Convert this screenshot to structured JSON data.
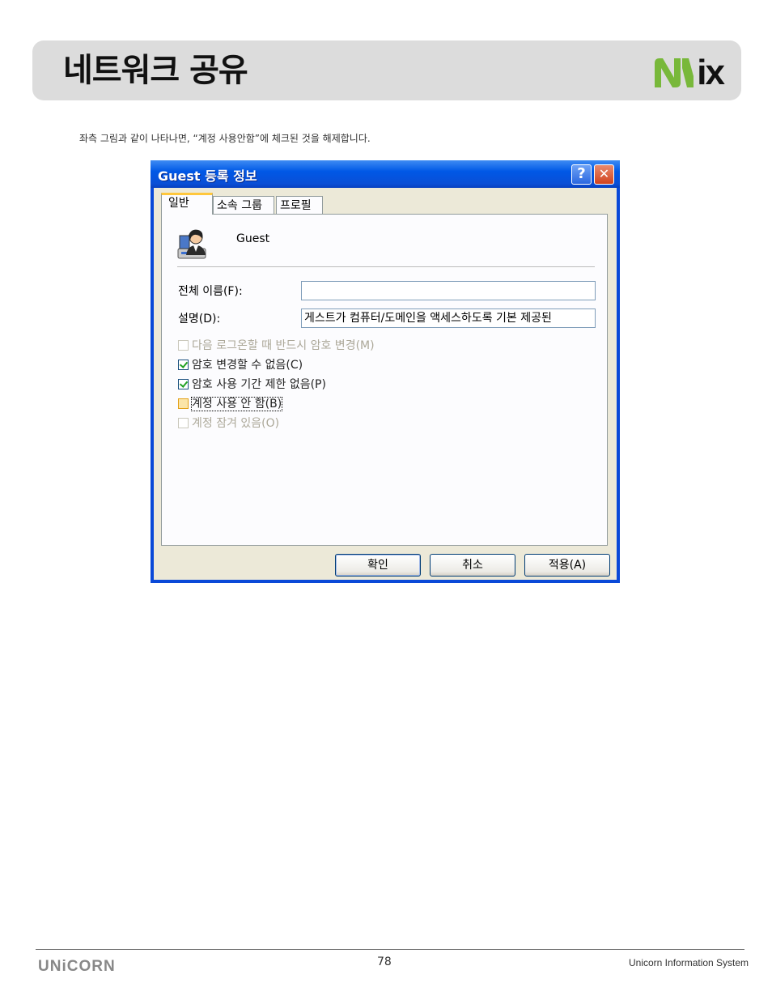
{
  "header": {
    "title": "네트워크 공유",
    "logo": {
      "text": "ix",
      "mark_color": "#78b83a"
    }
  },
  "instruction": "좌측 그림과 같이 나타나면, “계정 사용안함”에 체크된 것을 해제합니다.",
  "dialog": {
    "title": "Guest 등록 정보",
    "help_glyph": "?",
    "close_glyph": "✕",
    "tabs": [
      {
        "label": "일반",
        "active": true
      },
      {
        "label": "소속 그룹",
        "active": false
      },
      {
        "label": "프로필",
        "active": false
      }
    ],
    "user_name": "Guest",
    "fields": {
      "full_name": {
        "label": "전체 이름(F):",
        "value": ""
      },
      "description": {
        "label": "설명(D):",
        "value": "게스트가 컴퓨터/도메인을 액세스하도록 기본 제공된"
      }
    },
    "checkboxes": [
      {
        "label": "다음 로그온할 때 반드시 암호 변경(M)",
        "checked": false,
        "disabled": true
      },
      {
        "label": "암호 변경할 수 없음(C)",
        "checked": true,
        "disabled": false
      },
      {
        "label": "암호 사용 기간 제한 없음(P)",
        "checked": true,
        "disabled": false
      },
      {
        "label": "계정 사용 안 함(B)",
        "checked": false,
        "disabled": false,
        "focused": true
      },
      {
        "label": "계정 잠겨 있음(O)",
        "checked": false,
        "disabled": true
      }
    ],
    "buttons": {
      "ok": "확인",
      "cancel": "취소",
      "apply": "적용(A)"
    }
  },
  "footer": {
    "logo": "UNiCORN",
    "page_number": "78",
    "company": "Unicorn Information System"
  }
}
